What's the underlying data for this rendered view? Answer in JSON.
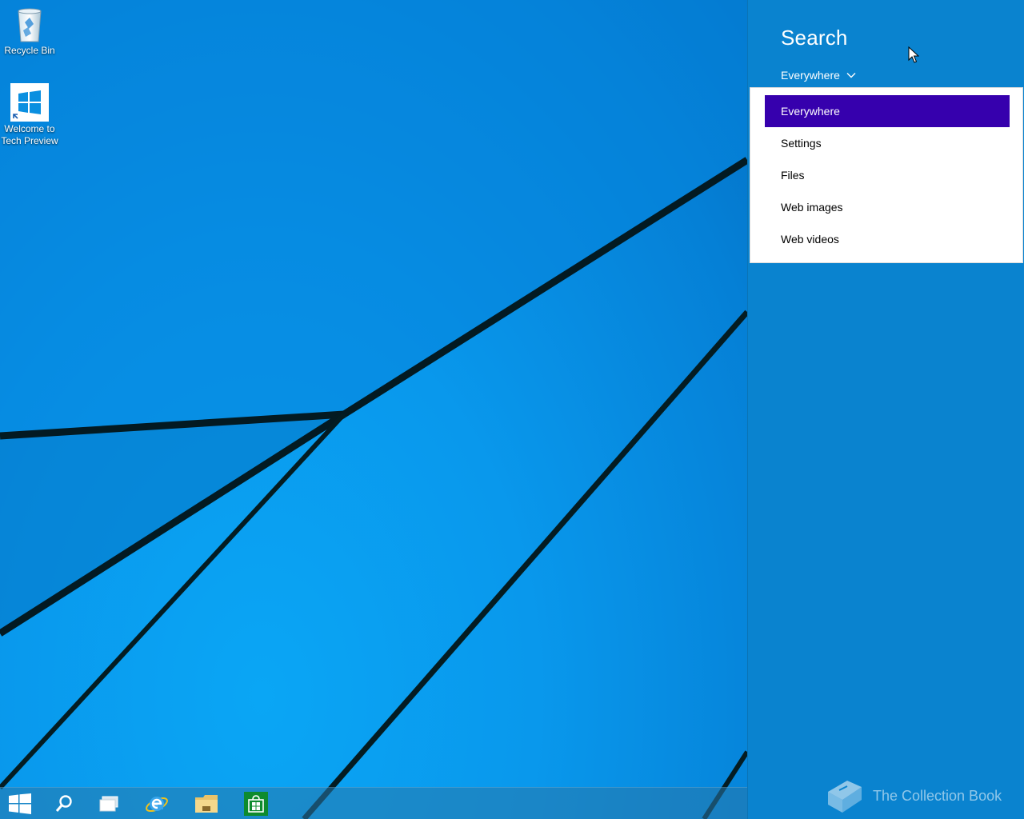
{
  "desktop": {
    "icons": [
      {
        "label": "Recycle Bin",
        "icon": "recycle-bin-icon"
      },
      {
        "label": "Welcome to Tech Preview",
        "icon": "windows-logo-icon"
      }
    ]
  },
  "taskbar": {
    "buttons": [
      {
        "name": "start",
        "icon": "windows-logo-icon"
      },
      {
        "name": "search",
        "icon": "search-icon"
      },
      {
        "name": "task-view",
        "icon": "task-view-icon"
      },
      {
        "name": "internet-explorer",
        "icon": "internet-explorer-icon"
      },
      {
        "name": "file-explorer",
        "icon": "folder-icon"
      },
      {
        "name": "store",
        "icon": "store-icon"
      }
    ]
  },
  "search_pane": {
    "title": "Search",
    "scope": {
      "selected": "Everywhere",
      "options": [
        "Everywhere",
        "Settings",
        "Files",
        "Web images",
        "Web videos"
      ]
    },
    "watermark": "The Collection Book"
  },
  "colors": {
    "charm_bg": "#0a83cf",
    "selected_item": "#3600ad",
    "desktop_blue": "#0998ec"
  }
}
